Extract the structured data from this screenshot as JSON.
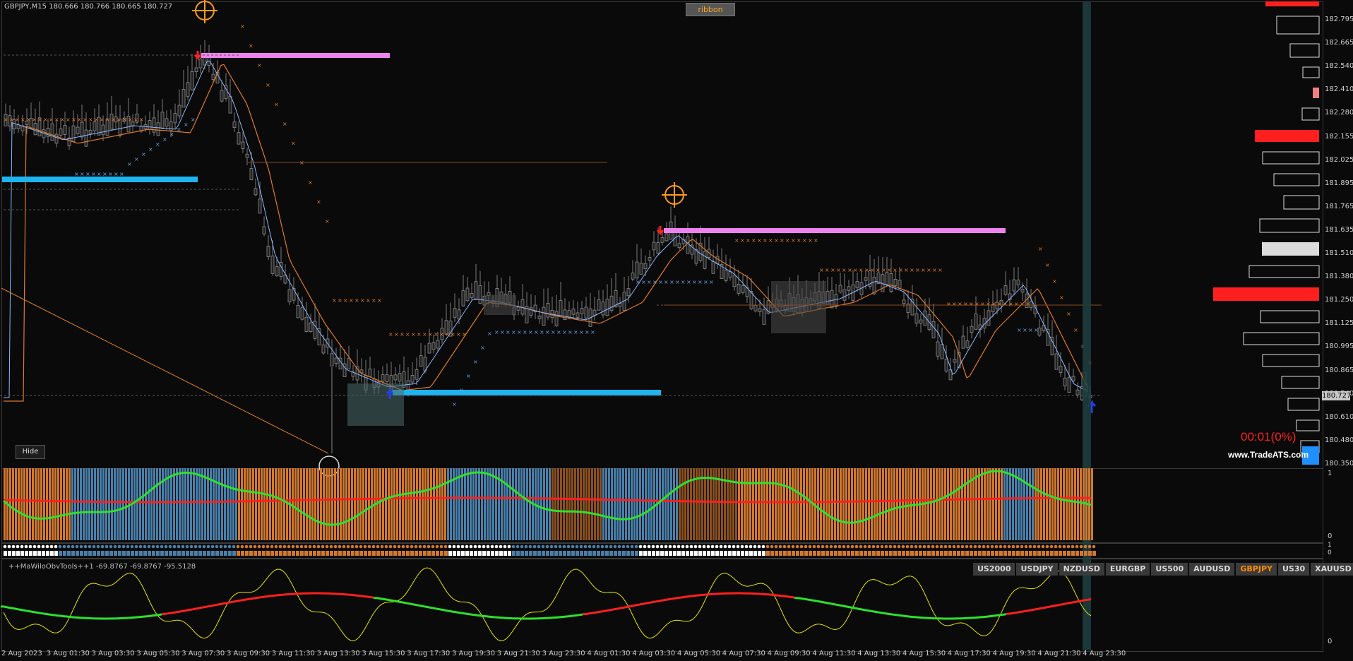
{
  "header": {
    "symbol_info": "GBPJPY,M15  180.666 180.766 180.665 180.727",
    "ribbon_label": "ribbon",
    "hide_label": "Hide"
  },
  "price_axis": [
    "182.795",
    "182.665",
    "182.540",
    "182.410",
    "182.280",
    "182.155",
    "182.025",
    "181.895",
    "181.765",
    "181.635",
    "181.510",
    "181.380",
    "181.250",
    "181.125",
    "180.995",
    "180.865",
    "180.740",
    "180.610",
    "180.480",
    "180.350"
  ],
  "current_price": "180.727",
  "timer": "00:01(0%)",
  "brand": "www.TradeATS.com",
  "ribbon_axis": [
    "1",
    "0"
  ],
  "dots_axis": [
    "1",
    "0"
  ],
  "obv": {
    "title": "++MaWiloObvTools++1 -69.8767 -69.8767 -95.5128",
    "axis": [
      "1",
      "0"
    ]
  },
  "symbols": [
    {
      "label": "US2000"
    },
    {
      "label": "USDJPY"
    },
    {
      "label": "NZDUSD"
    },
    {
      "label": "EURGBP"
    },
    {
      "label": "US500"
    },
    {
      "label": "AUDUSD"
    },
    {
      "label": "GBPJPY",
      "active": true
    },
    {
      "label": "US30"
    },
    {
      "label": "XAUUSD"
    }
  ],
  "time_axis": [
    "2 Aug 2023",
    "3 Aug 01:30",
    "3 Aug 03:30",
    "3 Aug 05:30",
    "3 Aug 07:30",
    "3 Aug 09:30",
    "3 Aug 11:30",
    "3 Aug 13:30",
    "3 Aug 15:30",
    "3 Aug 17:30",
    "3 Aug 19:30",
    "3 Aug 21:30",
    "3 Aug 23:30",
    "4 Aug 01:30",
    "4 Aug 03:30",
    "4 Aug 05:30",
    "4 Aug 07:30",
    "4 Aug 09:30",
    "4 Aug 11:30",
    "4 Aug 13:30",
    "4 Aug 15:30",
    "4 Aug 17:30",
    "4 Aug 19:30",
    "4 Aug 21:30",
    "4 Aug 23:30"
  ],
  "colors": {
    "up_bar": "#4a7faa",
    "down_bar": "#d2782f",
    "green": "#2ee02e",
    "red": "#ff1f1f",
    "pink": "#ee82ee",
    "cyan": "#1eb4f0",
    "orange": "#ff8c00"
  }
}
